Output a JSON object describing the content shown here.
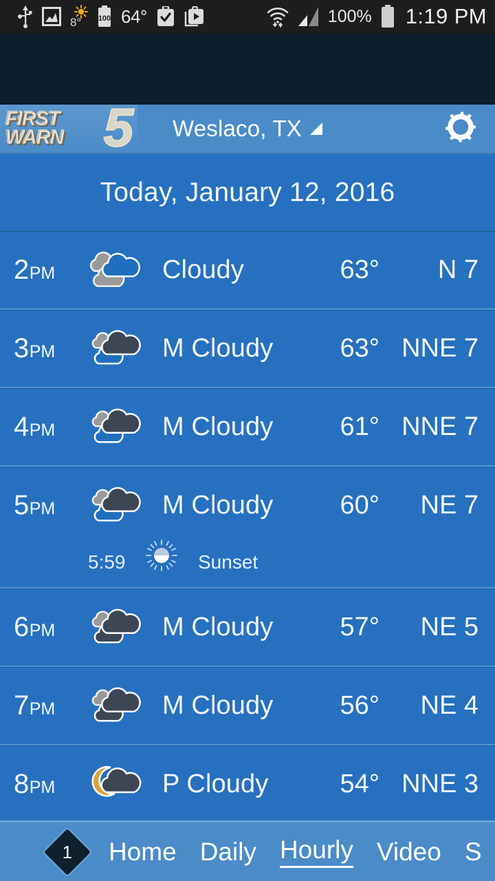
{
  "statusbar": {
    "icons_left": [
      "usb-icon",
      "gallery-icon",
      "brightness-icon",
      "battery-saver-icon",
      "checkbox-app-icon",
      "play-store-icon"
    ],
    "brightness_value": "8°",
    "battery_level_inline": "100",
    "temperature": "64°",
    "icons_right": [
      "wifi-icon",
      "cellular-signal-icon",
      "battery-icon"
    ],
    "battery_percent": "100%",
    "clock": "1:19 PM"
  },
  "appbar": {
    "logo_line1": "FIRST",
    "logo_line2": "WARN",
    "logo_number": "5",
    "location": "Weslaco, TX",
    "location_dropdown_icon": "triangle-dropdown-icon",
    "settings_icon": "gear-icon"
  },
  "date_header": {
    "title": "Today, January 12, 2016"
  },
  "hourly": {
    "rows": [
      {
        "hour": "2",
        "ampm": "PM",
        "icon": "cloudy-day-icon",
        "condition": "Cloudy",
        "temp": "63°",
        "wind": "N 7"
      },
      {
        "hour": "3",
        "ampm": "PM",
        "icon": "mostly-cloudy-day-icon",
        "condition": "M Cloudy",
        "temp": "63°",
        "wind": "NNE 7"
      },
      {
        "hour": "4",
        "ampm": "PM",
        "icon": "mostly-cloudy-day-icon",
        "condition": "M Cloudy",
        "temp": "61°",
        "wind": "NNE 7"
      },
      {
        "hour": "5",
        "ampm": "PM",
        "icon": "mostly-cloudy-day-icon",
        "condition": "M Cloudy",
        "temp": "60°",
        "wind": "NE 7",
        "event": {
          "time": "5:59",
          "icon": "sunset-icon",
          "label": "Sunset"
        }
      },
      {
        "hour": "6",
        "ampm": "PM",
        "icon": "mostly-cloudy-night-icon",
        "condition": "M Cloudy",
        "temp": "57°",
        "wind": "NE 5"
      },
      {
        "hour": "7",
        "ampm": "PM",
        "icon": "mostly-cloudy-night-icon",
        "condition": "M Cloudy",
        "temp": "56°",
        "wind": "NE 4"
      },
      {
        "hour": "8",
        "ampm": "PM",
        "icon": "partly-cloudy-night-icon",
        "condition": "P Cloudy",
        "temp": "54°",
        "wind": "NNE 3"
      }
    ]
  },
  "bottom_nav": {
    "badge_count": "1",
    "badge_icon": "diamond-badge-icon",
    "items": [
      {
        "label": "Home",
        "active": false
      },
      {
        "label": "Daily",
        "active": false
      },
      {
        "label": "Hourly",
        "active": true
      },
      {
        "label": "Video",
        "active": false
      },
      {
        "label": "S",
        "active": false
      }
    ],
    "more_icon": "chevron-right-icon"
  },
  "colors": {
    "status_bar_bg": "#1d1d1d",
    "dark_band_bg": "#0c1e2c",
    "app_bar_bg": "#4b8bc8",
    "content_bg": "#2770bf",
    "divider_dark": "#1b5da0",
    "divider_light": "#5090cd",
    "text_primary": "#ffffff",
    "moon_accent": "#d9a441",
    "cloud_blue": "#1f6fbe",
    "cloud_gray": "#9a9a9a",
    "cloud_dark": "#3c4654"
  }
}
